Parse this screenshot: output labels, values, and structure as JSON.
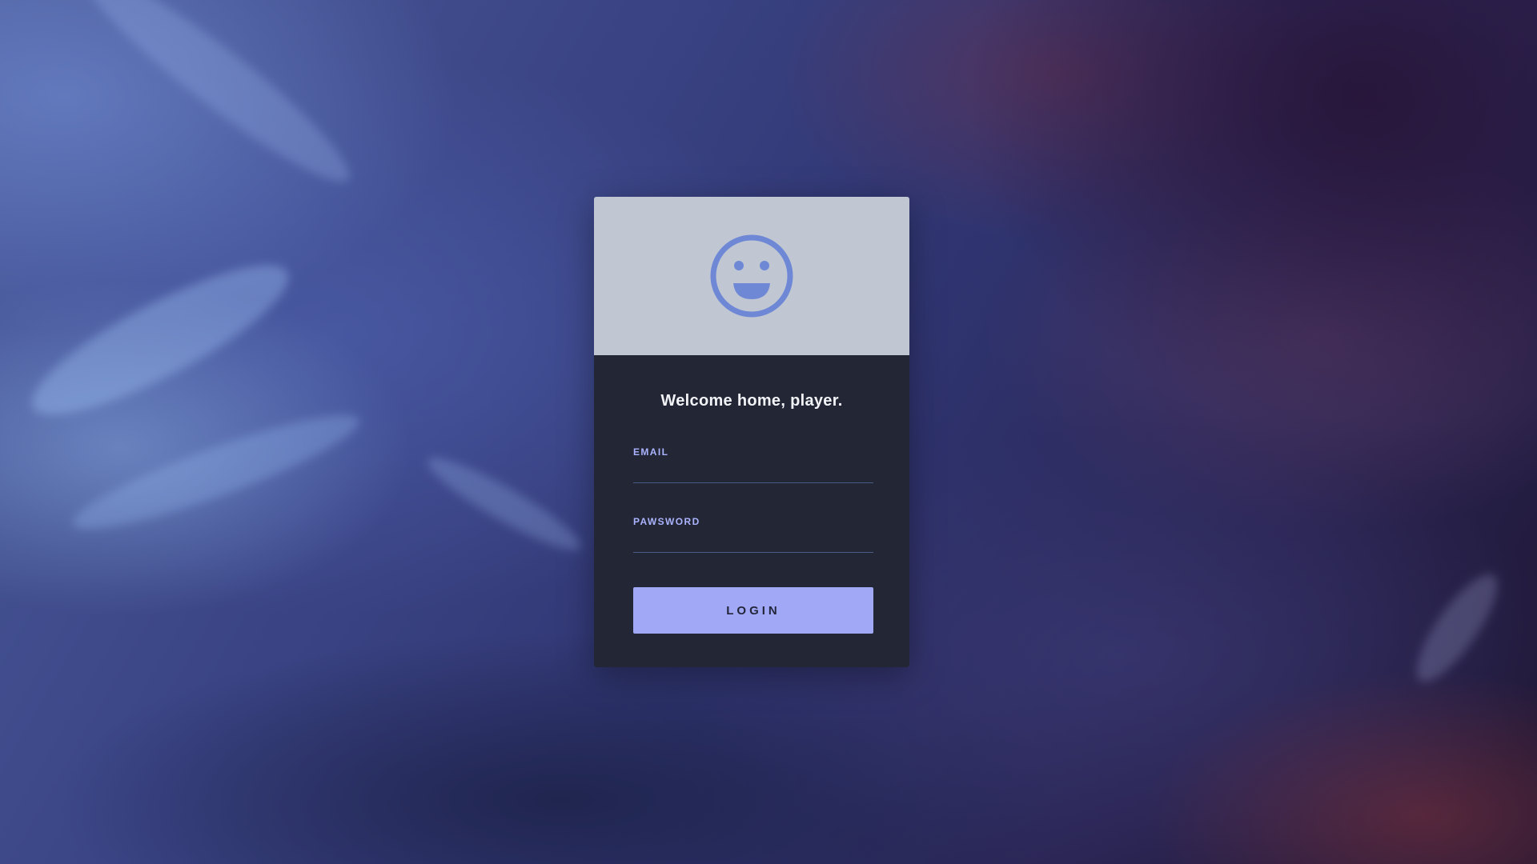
{
  "login_card": {
    "avatar_icon": "smiley-face-icon",
    "welcome_text": "Welcome home, player.",
    "email": {
      "label": "EMAIL",
      "value": "",
      "placeholder": ""
    },
    "password": {
      "label": "PAWSWORD",
      "value": "",
      "placeholder": ""
    },
    "login_button_label": "LOGIN"
  },
  "colors": {
    "header_bg": "#c0c7d3",
    "body_bg": "#232634",
    "accent": "#a1a8f6",
    "icon": "#6f88d6",
    "label": "#aab3ff"
  }
}
